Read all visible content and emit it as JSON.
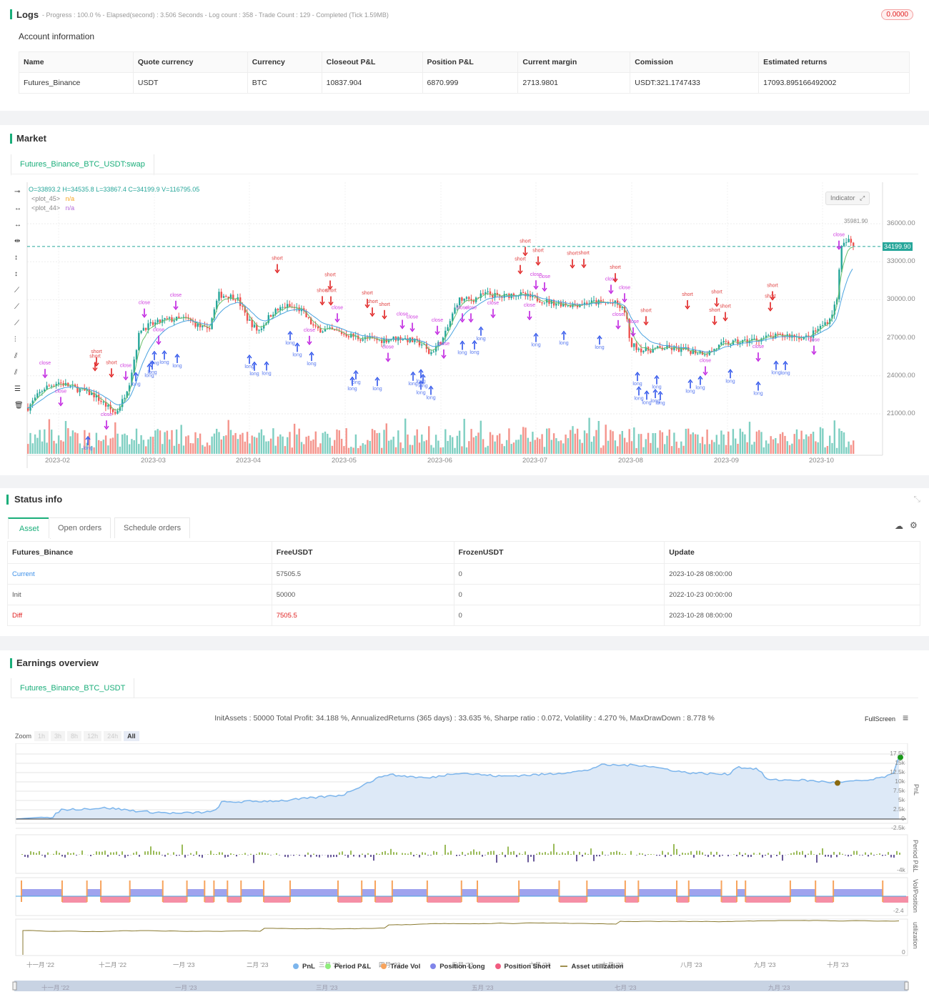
{
  "logs": {
    "title": "Logs",
    "summary": "- Progress : 100.0 % - Elapsed(second) : 3.506  Seconds - Log count : 358 - Trade Count : 129 - Completed (Tick 1.59MB)",
    "badge": "0.0000",
    "account_title": "Account information",
    "columns": [
      "Name",
      "Quote currency",
      "Currency",
      "Closeout P&L",
      "Position P&L",
      "Current margin",
      "Comission",
      "Estimated returns"
    ],
    "row": [
      "Futures_Binance",
      "USDT",
      "BTC",
      "10837.904",
      "6870.999",
      "2713.9801",
      "USDT:321.1747433",
      "17093.895166492002"
    ]
  },
  "market": {
    "title": "Market",
    "tab": "Futures_Binance_BTC_USDT:swap",
    "ohlc": "O=33893.2 H=34535.8 L=33867.4 C=34199.9 V=116795.05",
    "plots": [
      {
        "name": "<plot_45>",
        "value": "n/a",
        "color": "#f5a623"
      },
      {
        "name": "<plot_44>",
        "value": "n/a",
        "color": "#b36ad9"
      }
    ],
    "indicator_button": "Indicator",
    "last_price": "34199.90",
    "high_label": "35981.90",
    "y_ticks": [
      "36000.00",
      "33000.00",
      "30000.00",
      "27000.00",
      "24000.00",
      "21000.00"
    ],
    "x_ticks": [
      "2023-02",
      "2023-03",
      "2023-04",
      "2023-05",
      "2023-06",
      "2023-07",
      "2023-08",
      "2023-09",
      "2023-10"
    ],
    "marker_labels": {
      "long": "long",
      "short": "short",
      "close": "close"
    },
    "colors": {
      "up": "#26a69a",
      "down": "#ef5350",
      "long": "#2f54eb",
      "short": "#e02020",
      "close": "#c020e0"
    },
    "price_path": [
      [
        0,
        21500
      ],
      [
        22,
        23000
      ],
      [
        42,
        23500
      ],
      [
        62,
        23100
      ],
      [
        92,
        22500
      ],
      [
        122,
        21000
      ],
      [
        132,
        22000
      ],
      [
        142,
        23500
      ],
      [
        157,
        27700
      ],
      [
        192,
        28400
      ],
      [
        222,
        28500
      ],
      [
        252,
        27500
      ],
      [
        267,
        30400
      ],
      [
        292,
        30200
      ],
      [
        307,
        28500
      ],
      [
        322,
        27500
      ],
      [
        342,
        29000
      ],
      [
        362,
        29500
      ],
      [
        382,
        29200
      ],
      [
        402,
        27700
      ],
      [
        432,
        27500
      ],
      [
        462,
        27000
      ],
      [
        492,
        26800
      ],
      [
        522,
        27000
      ],
      [
        552,
        26500
      ],
      [
        562,
        25700
      ],
      [
        582,
        27000
      ],
      [
        602,
        30000
      ],
      [
        622,
        30000
      ],
      [
        642,
        30500
      ],
      [
        662,
        30200
      ],
      [
        682,
        30500
      ],
      [
        702,
        30200
      ],
      [
        732,
        29800
      ],
      [
        762,
        29600
      ],
      [
        792,
        29800
      ],
      [
        822,
        29700
      ],
      [
        837,
        29000
      ],
      [
        842,
        26500
      ],
      [
        862,
        26000
      ],
      [
        892,
        26200
      ],
      [
        922,
        26000
      ],
      [
        952,
        25800
      ],
      [
        972,
        26500
      ],
      [
        1002,
        26700
      ],
      [
        1032,
        27000
      ],
      [
        1062,
        27200
      ],
      [
        1092,
        27000
      ],
      [
        1102,
        27500
      ],
      [
        1122,
        28500
      ],
      [
        1132,
        30000
      ],
      [
        1137,
        34000
      ],
      [
        1147,
        34700
      ],
      [
        1157,
        34199.9
      ]
    ]
  },
  "status": {
    "title": "Status info",
    "tabs": [
      "Asset",
      "Open orders",
      "Schedule orders"
    ],
    "columns": [
      "Futures_Binance",
      "FreeUSDT",
      "FrozenUSDT",
      "Update"
    ],
    "rows": [
      [
        "Current",
        "57505.5",
        "0",
        "2023-10-28 08:00:00"
      ],
      [
        "Init",
        "50000",
        "0",
        "2022-10-23 00:00:00"
      ],
      [
        "Diff",
        "7505.5",
        "0",
        "2023-10-28 08:00:00"
      ]
    ]
  },
  "earnings": {
    "title": "Earnings overview",
    "tab": "Futures_Binance_BTC_USDT",
    "stats": "InitAssets : 50000 Total Profit: 34.188 %, AnnualizedReturns (365 days) : 33.635 %, Sharpe ratio : 0.072, Volatility : 4.270 %, MaxDrawDown : 8.778 %",
    "fullscreen": "FullScreen",
    "zoom_label": "Zoom",
    "zoom_options": [
      "1h",
      "3h",
      "8h",
      "12h",
      "24h",
      "All"
    ],
    "zoom_selected": "All",
    "pnl_ticks": [
      "17.5k",
      "15k",
      "12.5k",
      "10k",
      "7.5k",
      "5k",
      "2.5k",
      "0",
      "-2.5k"
    ],
    "period_tick": "-4k",
    "vol_tick": "-2.4",
    "util_tick": "0",
    "axis_titles": [
      "PnL",
      "Period P&L",
      "Vol/Position",
      "utilization"
    ],
    "x_ticks": [
      "十一月 '22",
      "十二月 '22",
      "一月 '23",
      "二月 '23",
      "三月 '23",
      "四月 '23",
      "五月 '23",
      "六月 '23",
      "七月 '23",
      "八月 '23",
      "九月 '23",
      "十月 '23"
    ],
    "nav_ticks": [
      "十一月 '22",
      "一月 '23",
      "三月 '23",
      "五月 '23",
      "七月 '23",
      "九月 '23"
    ],
    "legend": [
      {
        "name": "PnL",
        "color": "#7cb5ec"
      },
      {
        "name": "Period P&L",
        "color": "#90ed7d"
      },
      {
        "name": "Trade Vol",
        "color": "#f7a35c"
      },
      {
        "name": "Position Long",
        "color": "#8085e9"
      },
      {
        "name": "Position Short",
        "color": "#f15c80"
      },
      {
        "name": "Asset utilization",
        "color": "#a09050"
      }
    ],
    "pnl_path_k": [
      [
        0,
        0
      ],
      [
        38,
        0.5
      ],
      [
        48,
        0
      ],
      [
        63,
        2.5
      ],
      [
        128,
        3
      ],
      [
        178,
        2
      ],
      [
        228,
        1.5
      ],
      [
        278,
        2
      ],
      [
        288,
        4.5
      ],
      [
        378,
        5
      ],
      [
        458,
        6.5
      ],
      [
        473,
        8
      ],
      [
        518,
        12
      ],
      [
        578,
        11
      ],
      [
        618,
        12.5
      ],
      [
        678,
        11.5
      ],
      [
        738,
        12
      ],
      [
        798,
        13
      ],
      [
        818,
        14.5
      ],
      [
        878,
        14.5
      ],
      [
        938,
        12.5
      ],
      [
        998,
        12
      ],
      [
        1008,
        14
      ],
      [
        1038,
        13.5
      ],
      [
        1053,
        10.5
      ],
      [
        1098,
        10.5
      ],
      [
        1148,
        9.8
      ],
      [
        1198,
        10.5
      ],
      [
        1228,
        12
      ],
      [
        1236,
        17
      ]
    ]
  }
}
